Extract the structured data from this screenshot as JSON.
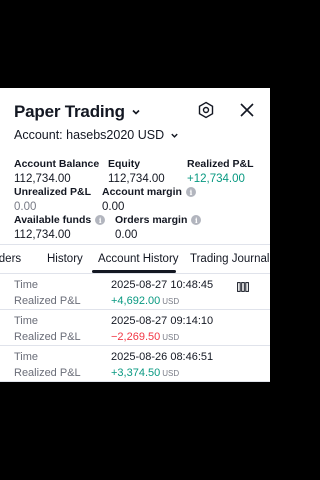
{
  "header": {
    "title": "Paper Trading",
    "account": "Account: hasebs2020 USD"
  },
  "metrics": {
    "account_balance": {
      "label": "Account Balance",
      "value": "112,734.00"
    },
    "equity": {
      "label": "Equity",
      "value": "112,734.00"
    },
    "realized_pnl": {
      "label": "Realized P&L",
      "value": "+12,734.00"
    },
    "unrealized_pnl": {
      "label": "Unrealized P&L",
      "value": "0.00"
    },
    "account_margin": {
      "label": "Account margin",
      "value": "0.00"
    },
    "available_funds": {
      "label": "Available funds",
      "value": "112,734.00"
    },
    "orders_margin": {
      "label": "Orders margin",
      "value": "0.00"
    }
  },
  "tabs": [
    {
      "label": "Orders"
    },
    {
      "label": "History"
    },
    {
      "label": "Account History",
      "active": true
    },
    {
      "label": "Trading Journal"
    }
  ],
  "history": [
    {
      "time_label": "Time",
      "time": "2025-08-27 10:48:45",
      "pnl_label": "Realized P&L",
      "pnl": "+4,692.00",
      "currency": "USD",
      "sign": "pos"
    },
    {
      "time_label": "Time",
      "time": "2025-08-27 09:14:10",
      "pnl_label": "Realized P&L",
      "pnl": "−2,269.50",
      "currency": "USD",
      "sign": "neg"
    },
    {
      "time_label": "Time",
      "time": "2025-08-26 08:46:51",
      "pnl_label": "Realized P&L",
      "pnl": "+3,374.50",
      "currency": "USD",
      "sign": "pos"
    }
  ],
  "colors": {
    "positive": "#089981",
    "negative": "#f23645",
    "text": "#131722"
  },
  "icons": {
    "settings": "gear-hex-icon",
    "close": "close-icon",
    "columns": "columns-icon"
  }
}
